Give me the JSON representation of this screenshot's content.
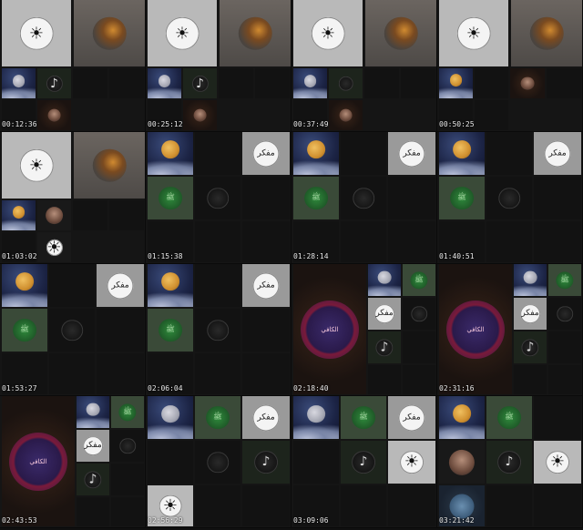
{
  "panels": [
    {
      "timestamp": "00:12:36"
    },
    {
      "timestamp": "00:25:12"
    },
    {
      "timestamp": "00:37:49"
    },
    {
      "timestamp": "00:50:25"
    },
    {
      "timestamp": "01:03:02"
    },
    {
      "timestamp": "01:15:38"
    },
    {
      "timestamp": "01:28:14"
    },
    {
      "timestamp": "01:40:51"
    },
    {
      "timestamp": "01:53:27"
    },
    {
      "timestamp": "02:06:04"
    },
    {
      "timestamp": "02:18:40"
    },
    {
      "timestamp": "02:31:16"
    },
    {
      "timestamp": "02:43:53"
    },
    {
      "timestamp": "02:56:29"
    },
    {
      "timestamp": "03:09:06"
    },
    {
      "timestamp": "03:21:42"
    }
  ],
  "labels": {
    "mutafakkir": "مفكر",
    "green_calligraphy": "ﷺ",
    "pink_calligraphy": "الكافي"
  },
  "colors": {
    "background": "#101010",
    "timestamp": "#e8e8e8",
    "tile_gray": "#b9b9b9",
    "tile_green": "#3a4a38"
  }
}
